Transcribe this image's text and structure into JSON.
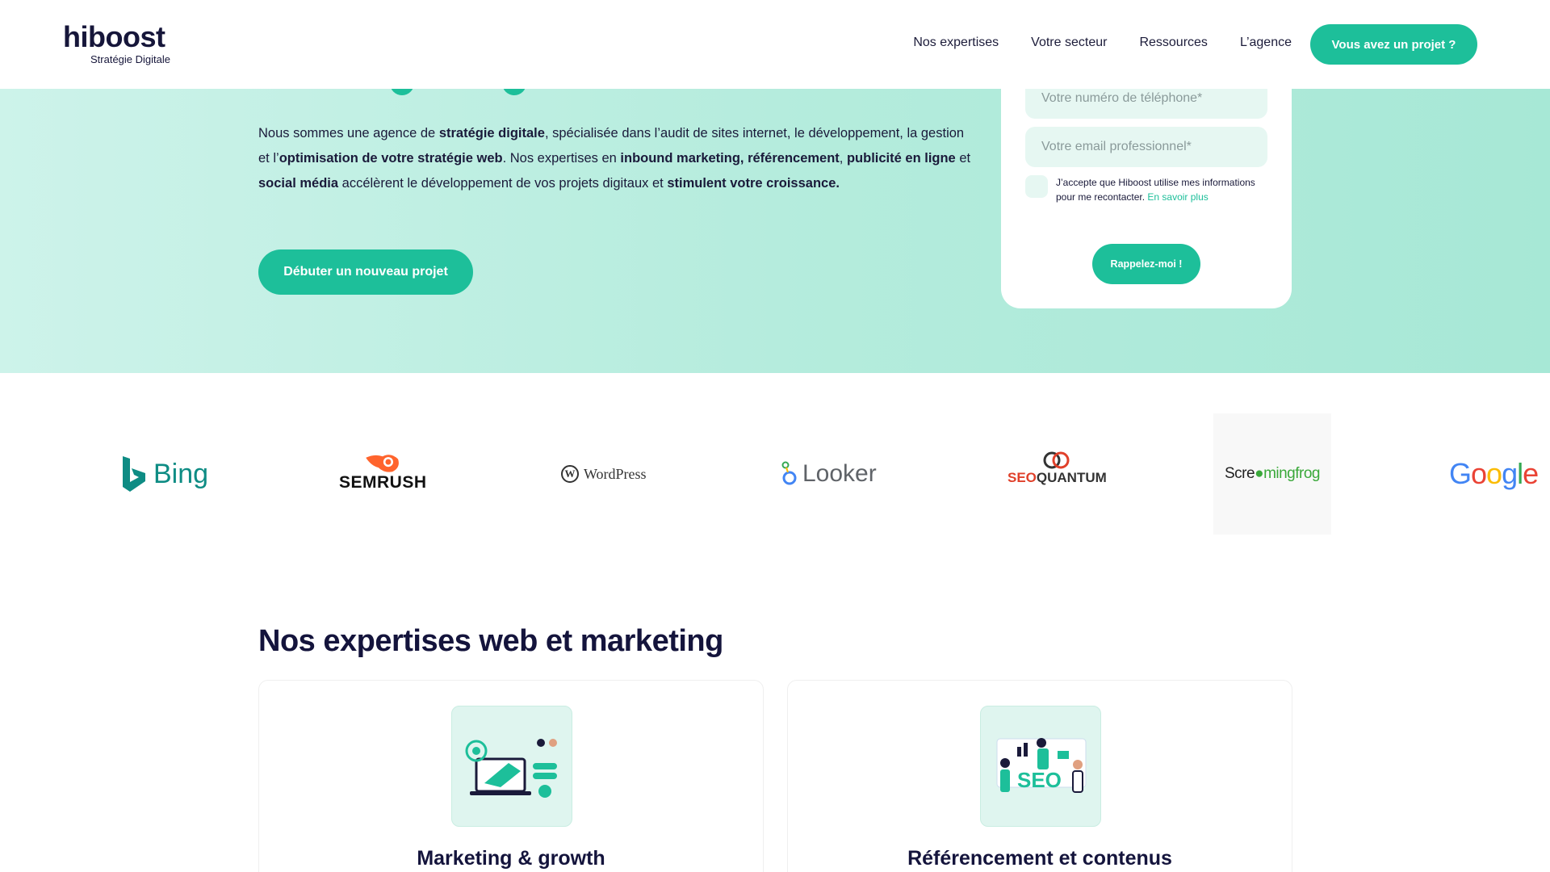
{
  "header": {
    "logo_name": "hiboost",
    "logo_sub": "Stratégie Digitale",
    "nav": [
      "Nos expertises",
      "Votre secteur",
      "Ressources",
      "L’agence"
    ],
    "cta": "Vous avez un projet ?"
  },
  "hero": {
    "p1": "Nous sommes une agence de ",
    "b1": "stratégie digitale",
    "p2": ", spécialisée dans l’audit de sites internet, le développement, la gestion et l’",
    "b2": "optimisation de votre stratégie web",
    "p3": ". Nos expertises en ",
    "b3": "inbound marketing, référencement",
    "p4": ", ",
    "b4": "publicité en ligne",
    "p5": " et ",
    "b5": "social média",
    "p6": " accélèrent le développement de vos projets digitaux et ",
    "b6": "stimulent votre croissance.",
    "button": "Débuter un nouveau projet"
  },
  "form": {
    "phone_placeholder": "Votre numéro de téléphone*",
    "email_placeholder": "Votre email professionnel*",
    "consent": "J’accepte que Hiboost utilise mes informations pour me recontacter. ",
    "consent_link": "En savoir plus",
    "submit": "Rappelez-moi !"
  },
  "logos": {
    "bing": "Bing",
    "semrush": "SEMRUSH",
    "wordpress": "WordPress",
    "looker": "Looker",
    "seoquantum_a": "SEO",
    "seoquantum_b": "QUANTUM",
    "frog_a": "Scre",
    "frog_b": "mingfrog",
    "google": "Google"
  },
  "expertises": {
    "title": "Nos expertises web et marketing",
    "cards": [
      {
        "title": "Marketing & growth",
        "icon": "marketing-illustration"
      },
      {
        "title": "Référencement et contenus",
        "icon": "seo-illustration"
      }
    ]
  },
  "colors": {
    "accent": "#1dbf9a",
    "navy": "#14143c",
    "hero_bg": "#b5ecdd"
  }
}
